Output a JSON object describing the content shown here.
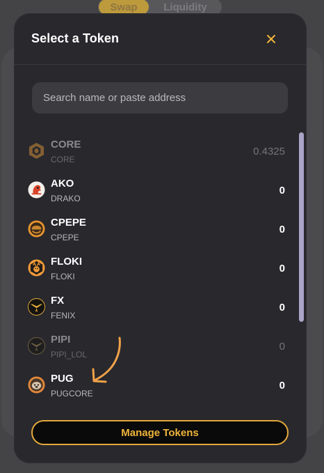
{
  "background": {
    "tabs": [
      {
        "label": "Swap",
        "active": true
      },
      {
        "label": "Liquidity",
        "active": false
      }
    ]
  },
  "modal": {
    "title": "Select a Token",
    "close_icon": "close-icon",
    "search_placeholder": "Search name or paste address",
    "search_value": "",
    "tokens": [
      {
        "symbol": "CORE",
        "name": "CORE",
        "balance": "0.4325",
        "dimmed": true,
        "icon": "core-hexagon-icon"
      },
      {
        "symbol": "AKO",
        "name": "DRAKO",
        "balance": "0",
        "dimmed": false,
        "icon": "drako-logo-icon"
      },
      {
        "symbol": "CPEPE",
        "name": "CPEPE",
        "balance": "0",
        "dimmed": false,
        "icon": "cpepe-logo-icon"
      },
      {
        "symbol": "FLOKI",
        "name": "FLOKI",
        "balance": "0",
        "dimmed": false,
        "icon": "floki-logo-icon"
      },
      {
        "symbol": "FX",
        "name": "FENIX",
        "balance": "0",
        "dimmed": false,
        "icon": "fenix-logo-icon"
      },
      {
        "symbol": "PIPI",
        "name": "PIPI_LOL",
        "balance": "0",
        "dimmed": true,
        "icon": "pipi-logo-icon"
      },
      {
        "symbol": "PUG",
        "name": "PUGCORE",
        "balance": "0",
        "dimmed": false,
        "icon": "pug-logo-icon"
      }
    ],
    "manage_label": "Manage Tokens"
  },
  "colors": {
    "accent": "#f0b43c",
    "modal_bg": "#29282d",
    "scrollbar": "#a9a4c8",
    "annotation_arrow": "#f0a24a"
  }
}
